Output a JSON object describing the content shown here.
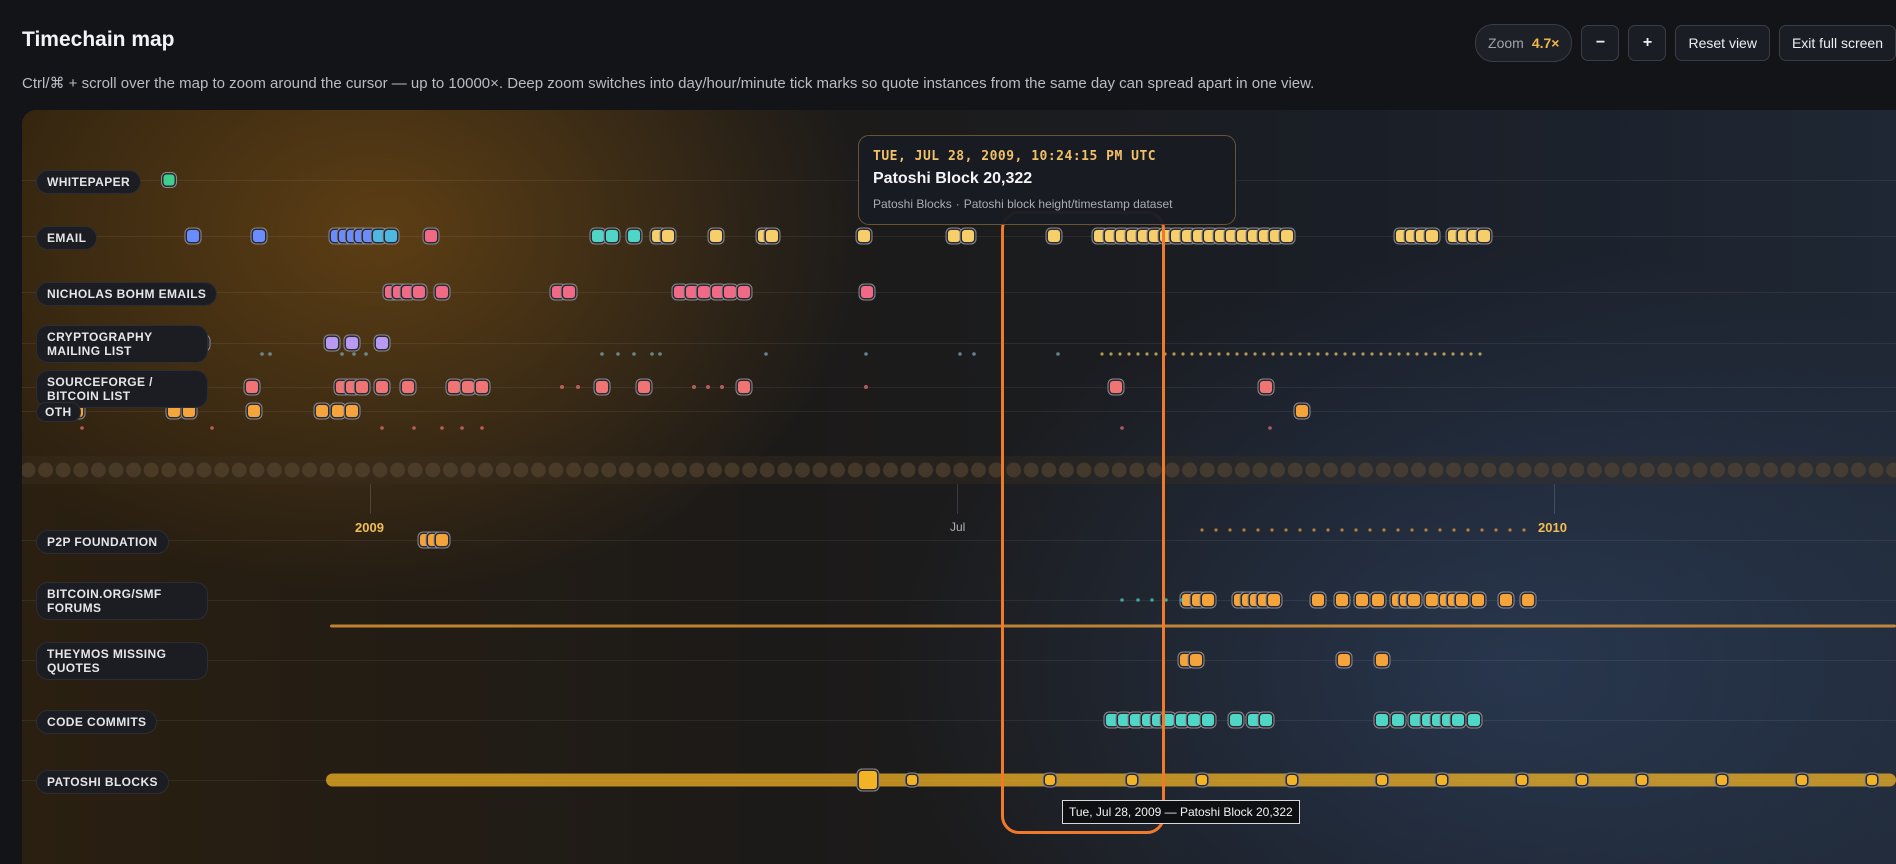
{
  "header": {
    "title": "Timechain map",
    "subtitle": "Ctrl/⌘ + scroll over the map to zoom around the cursor — up to 10000×. Deep zoom switches into day/hour/minute tick marks so quote instances from the same day can spread apart in one view."
  },
  "toolbar": {
    "zoom_label": "Zoom",
    "zoom_value": "4.7×",
    "zoom_out": "−",
    "zoom_in": "+",
    "reset": "Reset view",
    "exit_fullscreen": "Exit full screen"
  },
  "lanes": {
    "whitepaper": "WHITEPAPER",
    "email": "EMAIL",
    "bohm": "NICHOLAS BOHM EMAILS",
    "crypto": "CRYPTOGRAPHY MAILING LIST",
    "sourceforge": "SOURCEFORGE / BITCOIN LIST",
    "other": "OTH",
    "p2p": "P2P FOUNDATION",
    "forums": "BITCOIN.ORG/SMF FORUMS",
    "theymos": "THEYMOS MISSING QUOTES",
    "commits": "CODE COMMITS",
    "patoshi": "PATOSHI BLOCKS"
  },
  "axis": {
    "y2009": "2009",
    "jul": "Jul",
    "y2010": "2010"
  },
  "tooltip": {
    "date": "TUE, JUL 28, 2009, 10:24:15 PM UTC",
    "title": "Patoshi Block 20,322",
    "source": "Patoshi Blocks",
    "dataset": "Patoshi block height/timestamp dataset"
  },
  "hover_label": "Tue, Jul 28, 2009 — Patoshi Block 20,322",
  "colors": {
    "whitepaper": "#3fcf8e",
    "email_early": "#6a8cff",
    "email_late": "#f6cf6a",
    "bohm": "#f06a86",
    "crypto": "#b99af2",
    "sourceforge": "#f07474",
    "other": "#f4a43a",
    "p2p": "#f4a43a",
    "forums": "#f4a43a",
    "commits": "#4fd6c6",
    "patoshi": "#f2b324",
    "highlight": "#f07a2a"
  }
}
